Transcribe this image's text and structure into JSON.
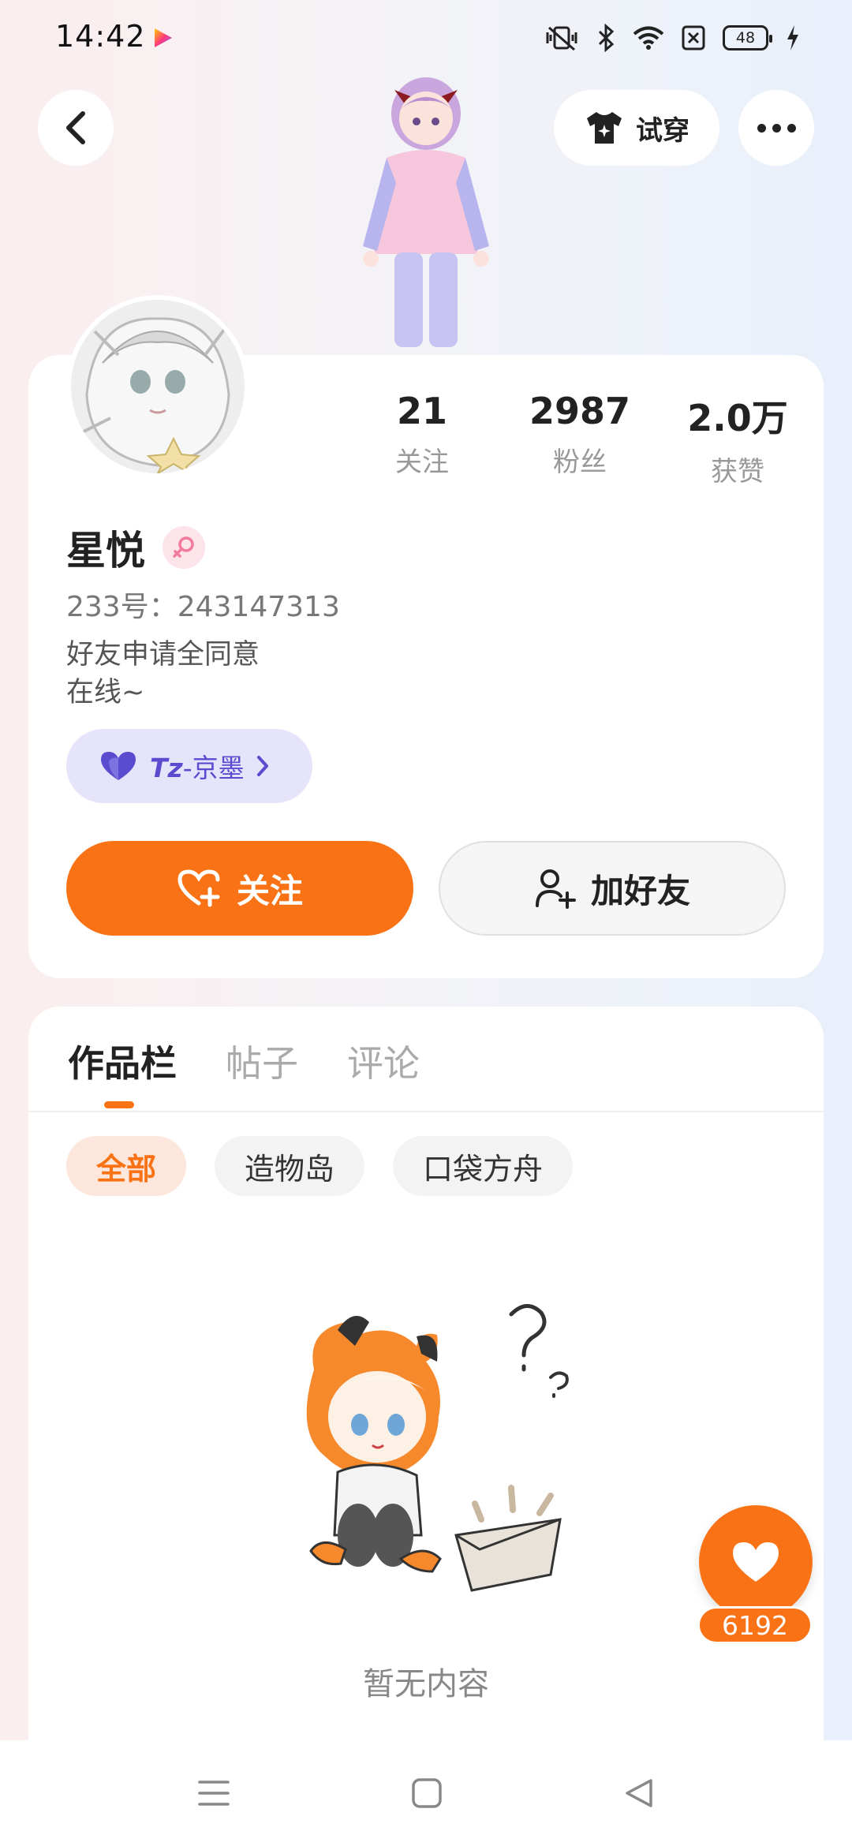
{
  "status_bar": {
    "time": "14:42",
    "battery": "48",
    "icons": [
      "vibrate-off-icon",
      "bluetooth-icon",
      "wifi-icon",
      "sim-off-icon",
      "battery-icon",
      "charging-icon"
    ]
  },
  "top_bar": {
    "tryon_label": "试穿"
  },
  "profile": {
    "stats": [
      {
        "value": "21",
        "label": "关注"
      },
      {
        "value": "2987",
        "label": "粉丝"
      },
      {
        "value": "2.0万",
        "label": "获赞"
      }
    ],
    "name": "星悦",
    "id_text": "233号：243147313",
    "bio_line1": "好友申请全同意",
    "bio_line2": "在线~",
    "guild_prefix": "Tz",
    "guild_name": "-京墨",
    "follow_label": "关注",
    "add_friend_label": "加好友"
  },
  "works": {
    "tabs": [
      "作品栏",
      "帖子",
      "评论"
    ],
    "filters": [
      "全部",
      "造物岛",
      "口袋方舟"
    ],
    "empty_text": "暂无内容"
  },
  "floating_like": {
    "count": "6192"
  },
  "colors": {
    "accent": "#f97316",
    "guild_bg": "#e6e4fb",
    "guild_text": "#5b4ccf"
  }
}
